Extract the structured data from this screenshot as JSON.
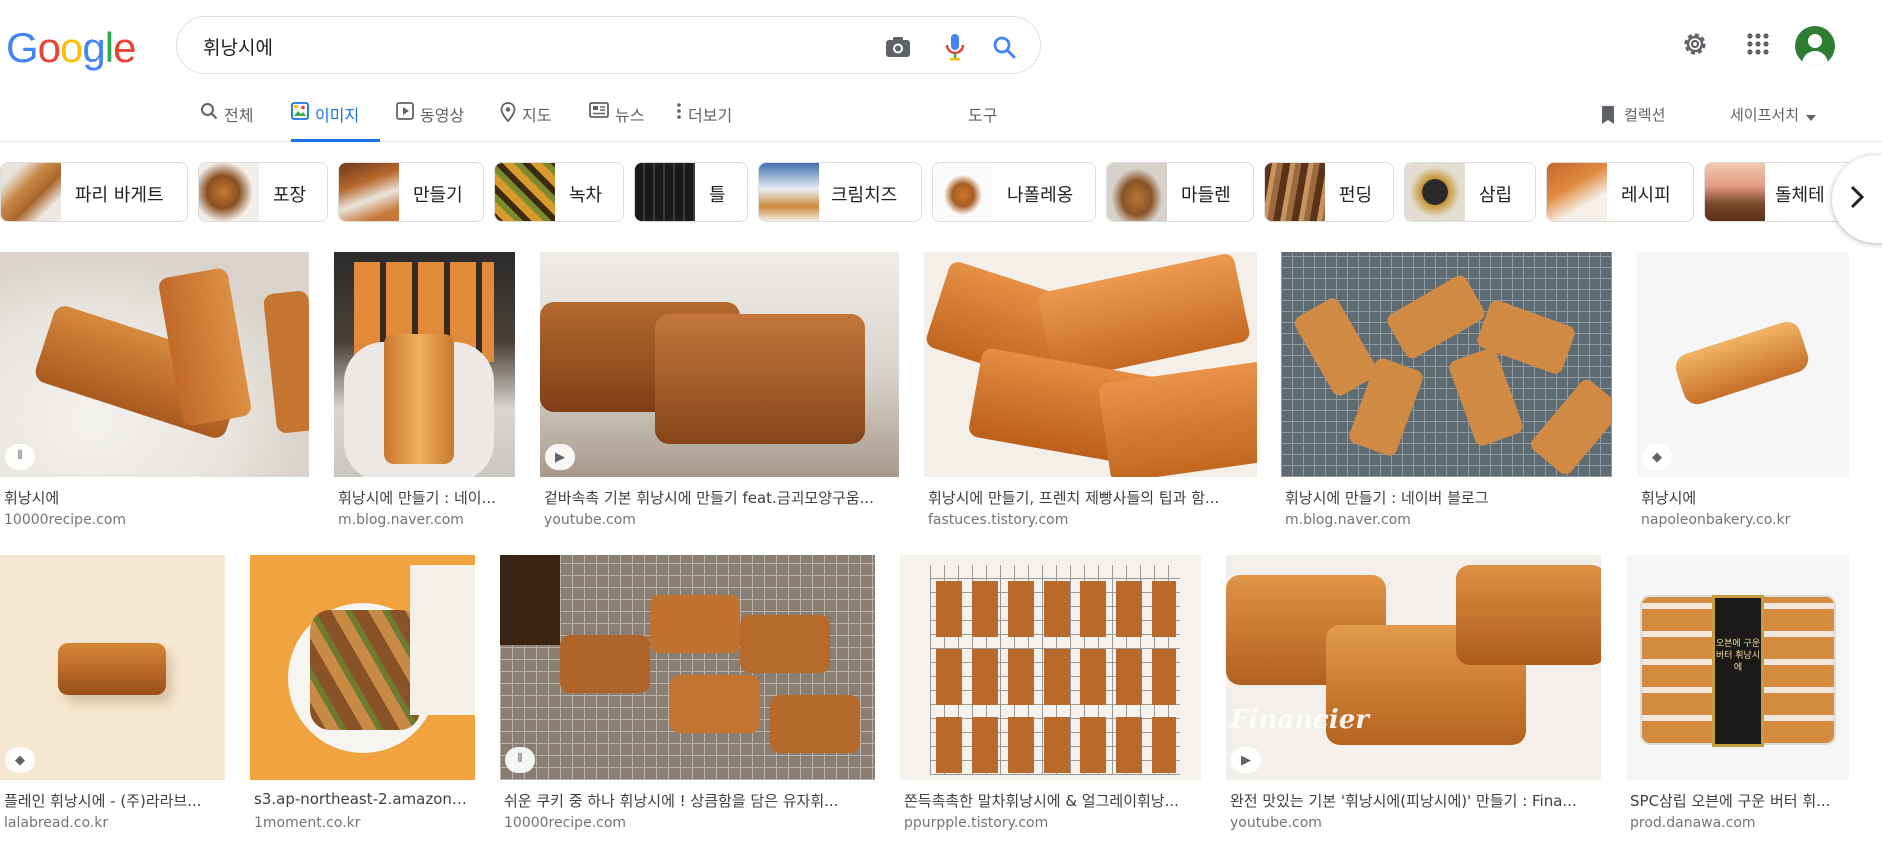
{
  "logo": {
    "letters": [
      "G",
      "o",
      "o",
      "g",
      "l",
      "e"
    ],
    "colors": [
      "#4285f4",
      "#ea4335",
      "#fbbc05",
      "#4285f4",
      "#34a853",
      "#ea4335"
    ]
  },
  "search": {
    "query": "휘낭시에"
  },
  "icons": {
    "camera": "camera-icon",
    "mic": "mic-icon",
    "search": "search-icon",
    "settings": "gear-icon",
    "apps": "apps-icon",
    "account": "avatar"
  },
  "tabs": [
    {
      "label": "전체",
      "icon": "search-icon"
    },
    {
      "label": "이미지",
      "icon": "image-icon",
      "active": true
    },
    {
      "label": "동영상",
      "icon": "play-icon"
    },
    {
      "label": "지도",
      "icon": "pin-icon"
    },
    {
      "label": "뉴스",
      "icon": "news-icon"
    },
    {
      "label": "더보기",
      "icon": "more-icon"
    }
  ],
  "tools_label": "도구",
  "collection_label": "컬렉션",
  "safesearch_label": "세이프서치",
  "chips": [
    "파리 바게트",
    "포장",
    "만들기",
    "녹차",
    "틀",
    "크림치즈",
    "나폴레옹",
    "마들렌",
    "펀딩",
    "삼립",
    "레시피",
    "돌체테"
  ],
  "results_row1": [
    {
      "title": "휘낭시에",
      "source": "10000recipe.com",
      "badge": "recipe"
    },
    {
      "title": "휘낭시에 만들기 : 네이...",
      "source": "m.blog.naver.com"
    },
    {
      "title": "겉바속촉 기본 휘낭시에 만들기 feat.금괴모양구움...",
      "source": "youtube.com",
      "badge": "video"
    },
    {
      "title": "휘낭시에 만들기, 프렌치 제빵사들의 팁과 함...",
      "source": "fastuces.tistory.com"
    },
    {
      "title": "휘낭시에 만들기 : 네이버 블로그",
      "source": "m.blog.naver.com"
    },
    {
      "title": "휘낭시에",
      "source": "napoleonbakery.co.kr",
      "badge": "product"
    }
  ],
  "results_row2": [
    {
      "title": "플레인 휘낭시에 - (주)라라브...",
      "source": "lalabread.co.kr",
      "badge": "product"
    },
    {
      "title": "s3.ap-northeast-2.amazonaw...",
      "source": "1moment.co.kr"
    },
    {
      "title": "쉬운 쿠키 중 하나 휘낭시에 ! 상큼함을 담은 유자휘...",
      "source": "10000recipe.com",
      "badge": "recipe"
    },
    {
      "title": "쫀득촉촉한 말차휘낭시에 & 얼그레이휘낭...",
      "source": "ppurpple.tistory.com"
    },
    {
      "title": "완전 맛있는 기본 '휘낭시에(피낭시에)' 만들기 : Fina...",
      "source": "youtube.com",
      "badge": "video",
      "overlay_text": "Financier"
    },
    {
      "title": "SPC삼립 오븐에 구운 버터 휘...",
      "source": "prod.danawa.com",
      "package_text": [
        "오븐에 구운",
        "버터 휘낭시에"
      ]
    }
  ]
}
